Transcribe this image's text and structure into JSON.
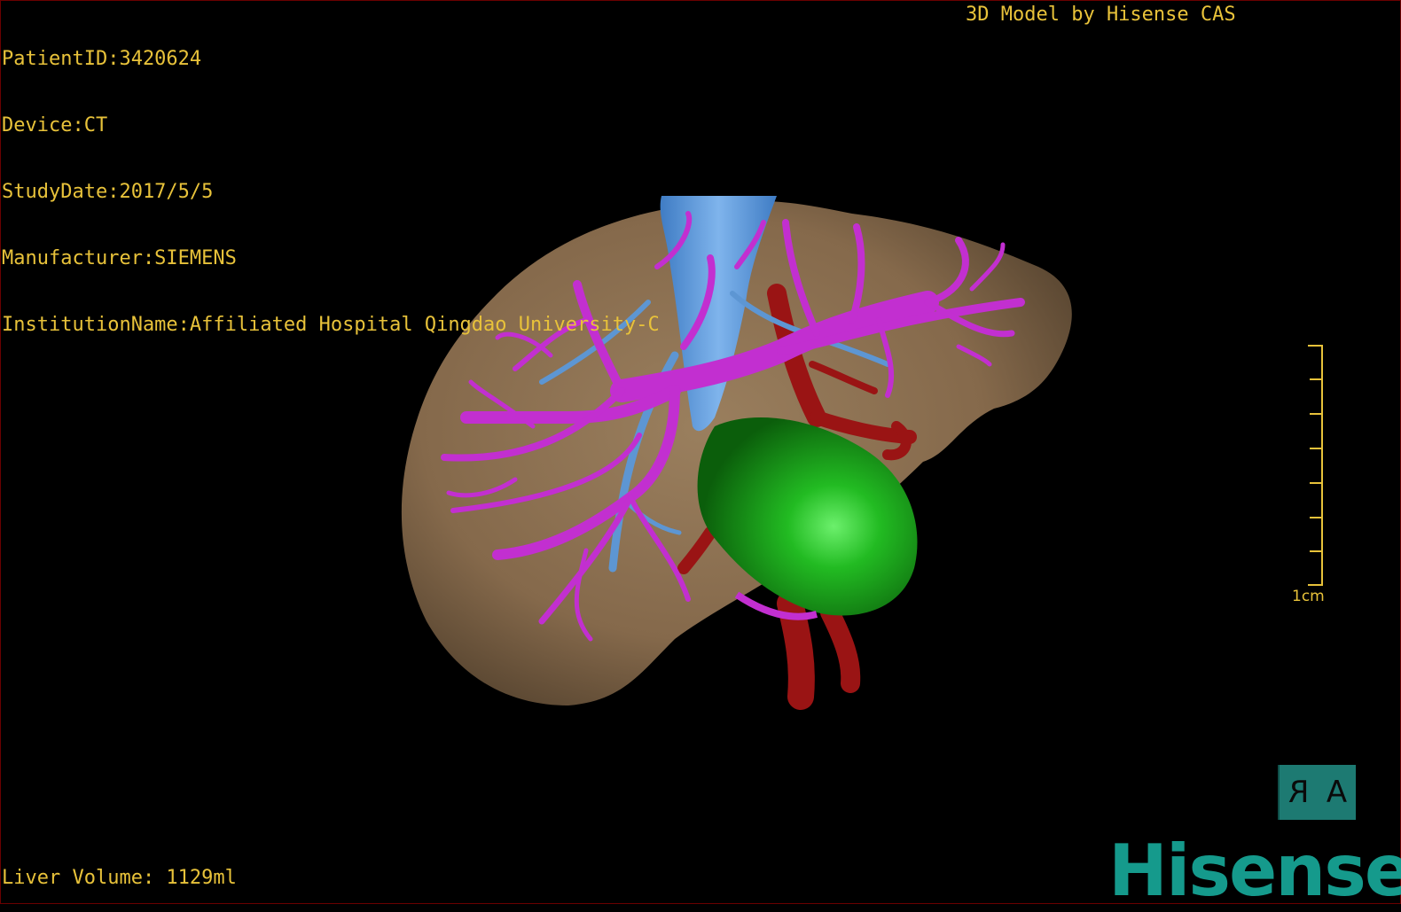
{
  "dicom": {
    "patient_id": "PatientID:3420624",
    "device": "Device:CT",
    "study_date": "StudyDate:2017/5/5",
    "manufacturer": "Manufacturer:SIEMENS",
    "institution": "InstitutionName:Affiliated Hospital Qingdao University-C"
  },
  "credit": "3D Model by Hisense CAS",
  "liver_volume": "Liver Volume: 1129ml",
  "scale": {
    "label": "1cm"
  },
  "orientation": {
    "left": "R",
    "right": "A"
  },
  "brand": "Hisense",
  "colors": {
    "overlay_text": "#e8c23a",
    "liver": "#8b7152",
    "portal_vein": "#c22fd0",
    "hepatic_vein": "#5d96d3",
    "artery": "#9a1414",
    "gallbladder": "#1ea51e",
    "brand": "#159a8c"
  }
}
